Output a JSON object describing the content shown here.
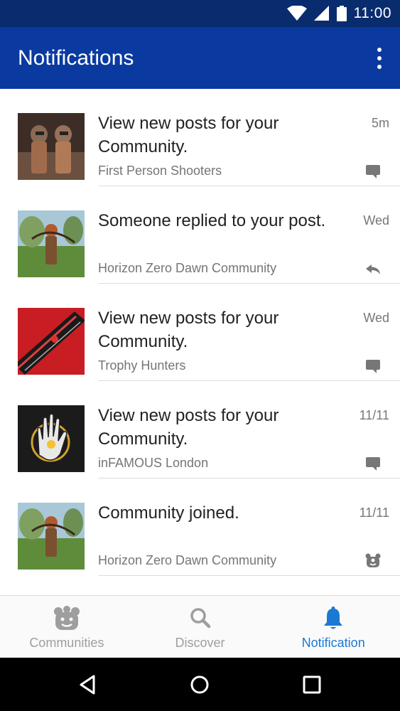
{
  "status_bar": {
    "time": "11:00"
  },
  "app_bar": {
    "title": "Notifications",
    "menu_icon": "more-vert-icon"
  },
  "notifications": [
    {
      "title": "View new posts for your Community.",
      "time": "5m",
      "community": "First Person Shooters",
      "action_icon": "comment-icon"
    },
    {
      "title": "Someone replied to your post.",
      "time": "Wed",
      "community": "Horizon Zero Dawn Community",
      "action_icon": "reply-icon"
    },
    {
      "title": "View new posts for your Community.",
      "time": "Wed",
      "community": "Trophy Hunters",
      "action_icon": "comment-icon"
    },
    {
      "title": "View new posts for your Community.",
      "time": "11/11",
      "community": "inFAMOUS London",
      "action_icon": "comment-icon"
    },
    {
      "title": "Community joined.",
      "time": "11/11",
      "community": "Horizon Zero Dawn Community",
      "action_icon": "community-icon"
    }
  ],
  "bottom_nav": [
    {
      "label": "Communities",
      "icon": "communities-icon",
      "active": false
    },
    {
      "label": "Discover",
      "icon": "search-icon",
      "active": false
    },
    {
      "label": "Notification",
      "icon": "bell-icon",
      "active": true
    }
  ],
  "colors": {
    "app_bar": "#0a3aa0",
    "status_bar": "#092c6f",
    "active_nav": "#1c79d3"
  }
}
